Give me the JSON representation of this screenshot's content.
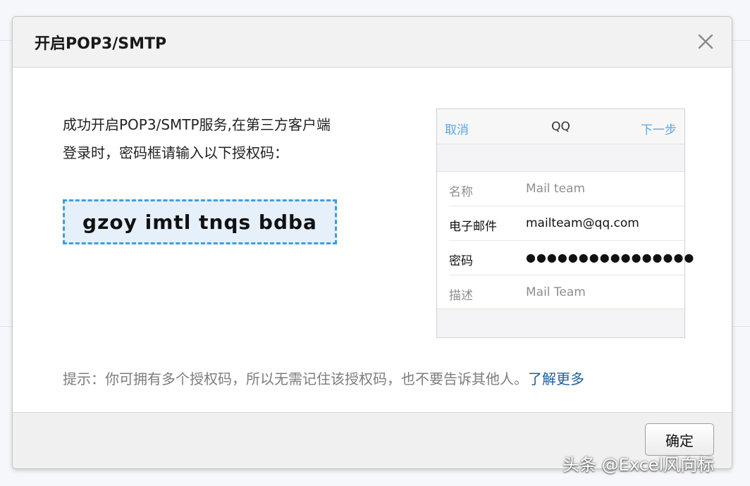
{
  "dialog": {
    "title": "开启POP3/SMTP",
    "close_icon": "close-icon"
  },
  "intro": {
    "line1": "成功开启POP3/SMTP服务,在第三方客户端",
    "line2": "登录时，密码框请输入以下授权码："
  },
  "auth_code": "gzoy imtl tnqs bdba",
  "preview": {
    "nav": {
      "cancel": "取消",
      "title": "QQ",
      "next": "下一步"
    },
    "rows": [
      {
        "label": "名称",
        "value": "Mail team"
      },
      {
        "label": "电子邮件",
        "value": "mailteam@qq.com"
      },
      {
        "label": "密码",
        "value": "●●●●●●●●●●●●●●●●"
      },
      {
        "label": "描述",
        "value": "Mail Team"
      }
    ]
  },
  "tip": {
    "text": "提示：你可拥有多个授权码，所以无需记住该授权码，也不要告诉其他人。",
    "link": "了解更多"
  },
  "footer": {
    "ok_label": "确定"
  },
  "watermark": "头条 @Excel风向标",
  "colors": {
    "accent_blue": "#3f9edc",
    "link_blue": "#1f5f9e",
    "nav_blue": "#5aa6e6",
    "code_bg": "#e5f0fb"
  }
}
